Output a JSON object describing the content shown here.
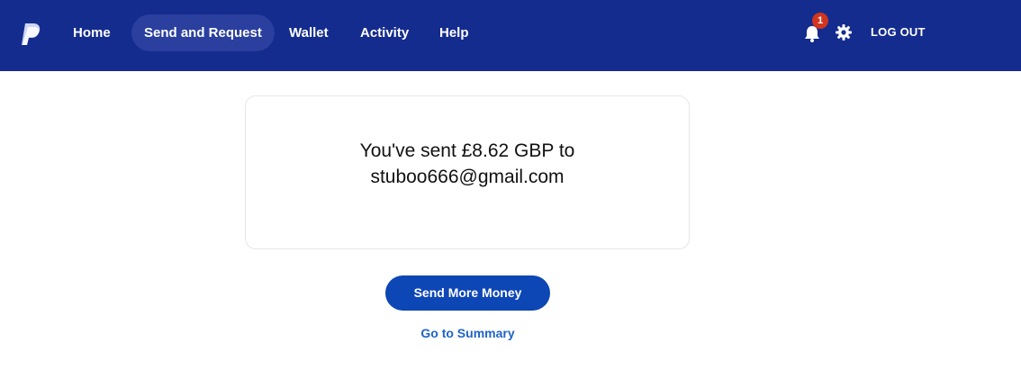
{
  "nav": {
    "items": [
      {
        "label": "Home",
        "active": false
      },
      {
        "label": "Send and Request",
        "active": true
      },
      {
        "label": "Wallet",
        "active": false
      },
      {
        "label": "Activity",
        "active": false
      },
      {
        "label": "Help",
        "active": false
      }
    ],
    "notification_count": "1",
    "logout_label": "LOG OUT",
    "icons": [
      "paypal-logo",
      "bell-icon",
      "gear-icon"
    ]
  },
  "confirmation": {
    "line1": "You've sent £8.62 GBP to",
    "line2": "stuboo666@gmail.com"
  },
  "actions": {
    "send_more_label": "Send More Money",
    "summary_label": "Go to Summary"
  },
  "colors": {
    "header_bg": "#142c8e",
    "active_nav_bg": "#2a3f9e",
    "badge": "#d0361e",
    "primary_button": "#0d46b5",
    "link": "#1f63c6"
  }
}
